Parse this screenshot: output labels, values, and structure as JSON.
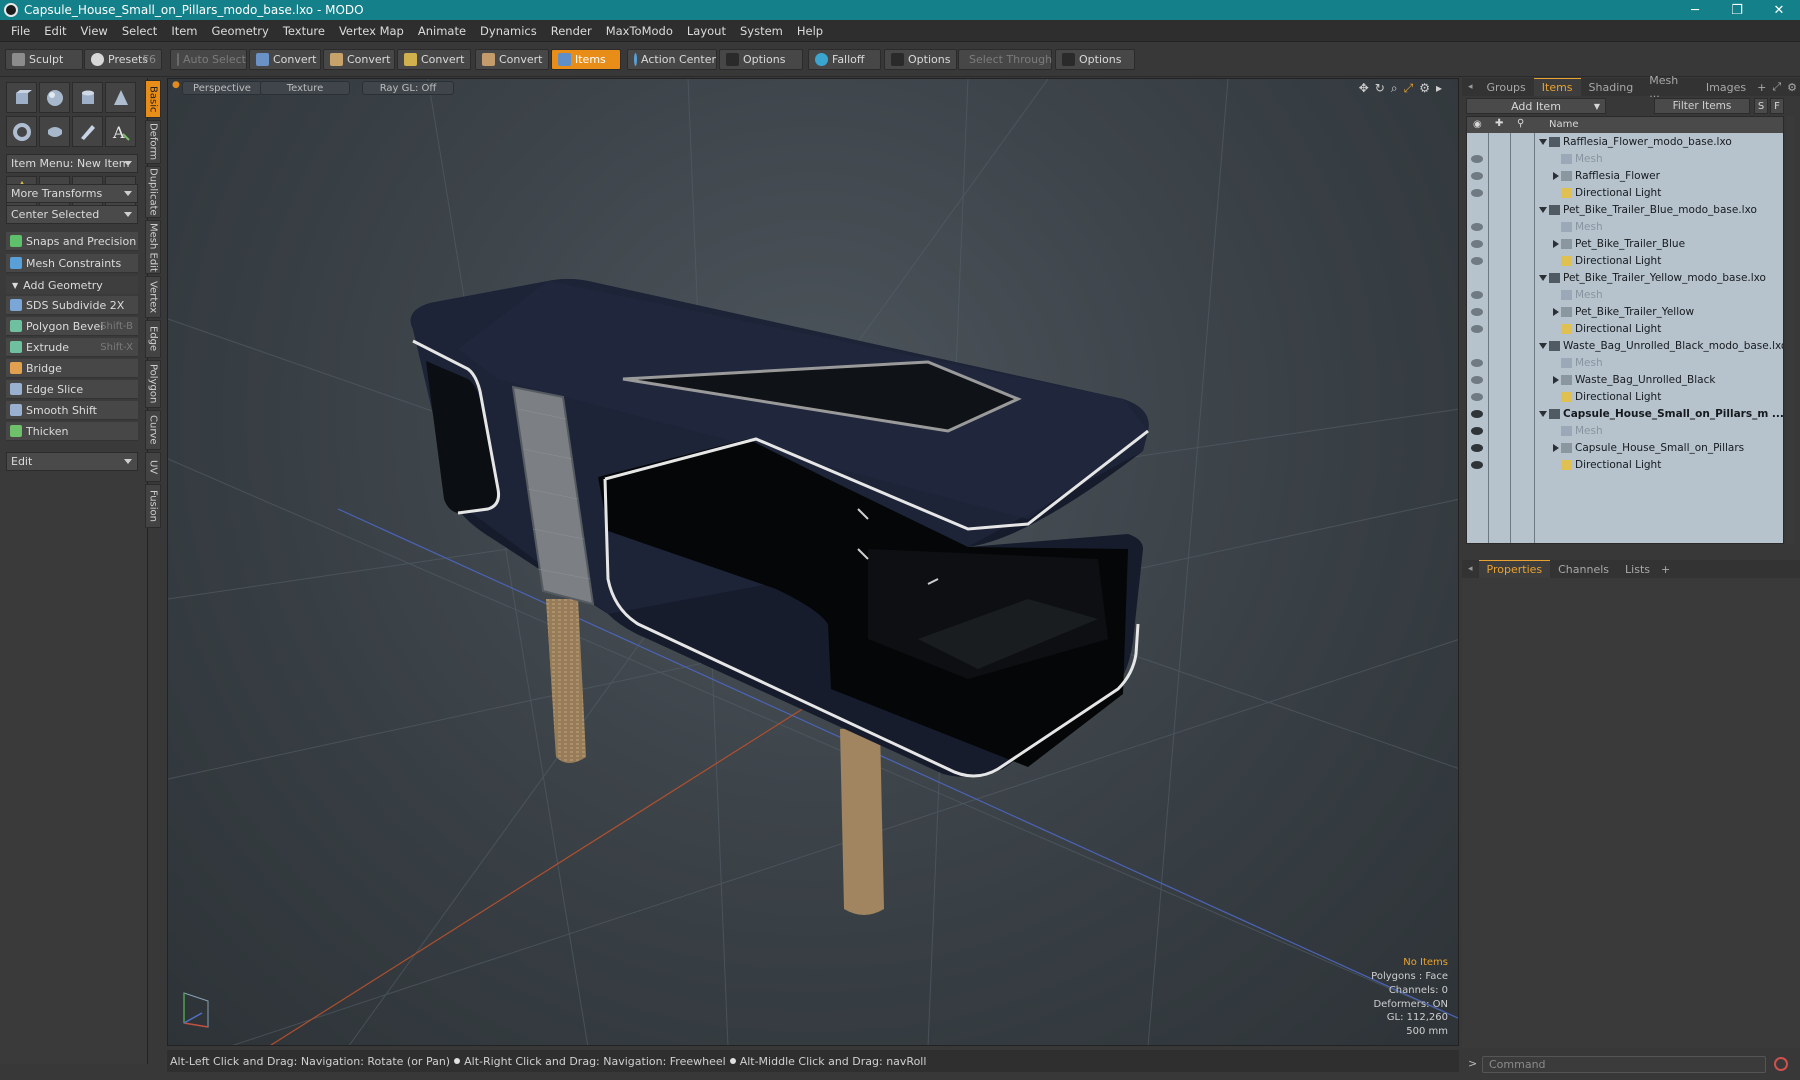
{
  "window": {
    "title": "Capsule_House_Small_on_Pillars_modo_base.lxo - MODO",
    "minimize": "─",
    "maximize": "❐",
    "close": "✕"
  },
  "menu": [
    "File",
    "Edit",
    "View",
    "Select",
    "Item",
    "Geometry",
    "Texture",
    "Vertex Map",
    "Animate",
    "Dynamics",
    "Render",
    "MaxToModo",
    "Layout",
    "System",
    "Help"
  ],
  "toolbar": {
    "sculpt": "Sculpt",
    "presets": "Presets",
    "presets_key": "F6",
    "auto_select": "Auto Select",
    "convert1": "Convert",
    "convert2": "Convert",
    "convert3": "Convert",
    "convert4": "Convert",
    "items": "Items",
    "action_center": "Action Center",
    "options1": "Options",
    "falloff": "Falloff",
    "options2": "Options",
    "select_through": "Select Through",
    "options3": "Options"
  },
  "left": {
    "item_menu": "Item Menu: New Item",
    "more_transforms": "More Transforms",
    "center_selected": "Center Selected",
    "snaps": "Snaps and Precision",
    "mesh_constraints": "Mesh Constraints",
    "add_geometry": "Add Geometry",
    "tools": [
      {
        "label": "SDS Subdivide 2X",
        "key": ""
      },
      {
        "label": "Polygon Bevel",
        "key": "Shift-B"
      },
      {
        "label": "Extrude",
        "key": "Shift-X"
      },
      {
        "label": "Bridge",
        "key": ""
      },
      {
        "label": "Edge Slice",
        "key": ""
      },
      {
        "label": "Smooth Shift",
        "key": ""
      },
      {
        "label": "Thicken",
        "key": ""
      }
    ],
    "edit": "Edit"
  },
  "vtabs": [
    "Basic",
    "Deform",
    "Duplicate",
    "Mesh Edit",
    "Vertex",
    "Edge",
    "Polygon",
    "Curve",
    "UV",
    "Fusion"
  ],
  "viewport": {
    "perspective": "Perspective",
    "texture": "Texture",
    "raygl": "Ray GL: Off"
  },
  "info": {
    "no_items": "No Items",
    "polygons": "Polygons : Face",
    "channels": "Channels: 0",
    "deformers": "Deformers: ON",
    "gl": "GL: 112,260",
    "scale": "500 mm"
  },
  "status": {
    "s1": "Alt-Left Click and Drag: Navigation: Rotate (or Pan)",
    "s2": "Alt-Right Click and Drag: Navigation: Freewheel",
    "s3": "Alt-Middle Click and Drag: navRoll"
  },
  "right": {
    "tabs": [
      "Groups",
      "Items",
      "Shading",
      "Mesh ...",
      "Images"
    ],
    "add_item": "Add Item",
    "filter": "Filter Items",
    "btn_s": "S",
    "btn_f": "F",
    "col_name": "Name",
    "rows": [
      {
        "label": "Rafflesia_Flower_modo_base.lxo",
        "kind": "scene"
      },
      {
        "label": "Mesh",
        "kind": "mesh"
      },
      {
        "label": "Rafflesia_Flower",
        "kind": "group"
      },
      {
        "label": "Directional Light",
        "kind": "light"
      },
      {
        "label": "Pet_Bike_Trailer_Blue_modo_base.lxo",
        "kind": "scene"
      },
      {
        "label": "Mesh",
        "kind": "mesh"
      },
      {
        "label": "Pet_Bike_Trailer_Blue",
        "kind": "group"
      },
      {
        "label": "Directional Light",
        "kind": "light"
      },
      {
        "label": "Pet_Bike_Trailer_Yellow_modo_base.lxo",
        "kind": "scene"
      },
      {
        "label": "Mesh",
        "kind": "mesh"
      },
      {
        "label": "Pet_Bike_Trailer_Yellow",
        "kind": "group"
      },
      {
        "label": "Directional Light",
        "kind": "light"
      },
      {
        "label": "Waste_Bag_Unrolled_Black_modo_base.lxo*",
        "kind": "scene"
      },
      {
        "label": "Mesh",
        "kind": "mesh"
      },
      {
        "label": "Waste_Bag_Unrolled_Black",
        "kind": "group"
      },
      {
        "label": "Directional Light",
        "kind": "light"
      },
      {
        "label": "Capsule_House_Small_on_Pillars_m ...",
        "kind": "scene"
      },
      {
        "label": "Mesh",
        "kind": "mesh"
      },
      {
        "label": "Capsule_House_Small_on_Pillars",
        "kind": "group"
      },
      {
        "label": "Directional Light",
        "kind": "light"
      }
    ],
    "prop_tabs": [
      "Properties",
      "Channels",
      "Lists"
    ],
    "command": "Command"
  }
}
